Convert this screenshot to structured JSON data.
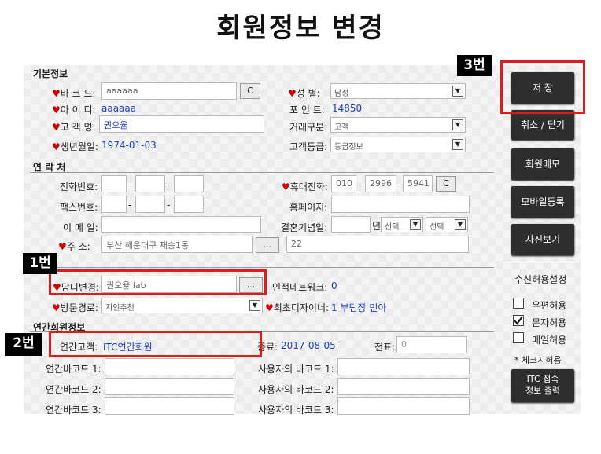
{
  "page_title": "회원정보 변경",
  "tags": {
    "tag1": "1번",
    "tag2": "2번",
    "tag3": "3번"
  },
  "sections": {
    "basic": "기본정보",
    "contact": "연 락 처",
    "annual": "연간회원정보"
  },
  "basic": {
    "barcode_label": "바 코 드:",
    "barcode_value": "aaaaaa",
    "barcode_btn": "C",
    "id_label": "아 이 디:",
    "id_value": "aaaaaa",
    "name_label": "고 객 명:",
    "name_value": "권오율",
    "birth_label": "생년월일:",
    "birth_value": "1974-01-03",
    "gender_label": "성    별:",
    "gender_value": "남성",
    "points_label": "포 인 트:",
    "points_value": "14850",
    "trade_label": "거래구분:",
    "trade_value": "고객",
    "grade_label": "고객등급:",
    "grade_value": "등급정보"
  },
  "contact": {
    "phone_label": "전화번호:",
    "fax_label": "팩스번호:",
    "email_label": "이 메 일:",
    "address_label": "주    소:",
    "address_value": "부산 해운대구 재송1동",
    "address_btn": "...",
    "address_detail": "22",
    "mobile_label": "휴대전화:",
    "mobile_1": "010",
    "mobile_2": "2996",
    "mobile_3": "5941",
    "mobile_btn": "C",
    "homepage_label": "홈페이지:",
    "anniv_label": "결혼기념일:",
    "year_suffix": "년",
    "select_a": "선택",
    "select_b": "선택"
  },
  "manager": {
    "manager_label": "담디변경:",
    "manager_value": "권오율  lab",
    "manager_btn": "...",
    "network_label": "인적네트워크:",
    "network_value": "0",
    "visit_label": "방문경로:",
    "visit_value": "지인추천",
    "designer_label": "최초디자이너:",
    "designer_value": "1 부팀장 민아"
  },
  "annual": {
    "customer_label": "연간고객:",
    "customer_value": "ITC연간회원",
    "end_label": "종료:",
    "end_value": "2017-08-05",
    "ticket_label": "전표:",
    "ticket_value": "0",
    "barcode1": "연간바코드 1:",
    "barcode2": "연간바코드 2:",
    "barcode3": "연간바코드 3:",
    "user_barcode1": "사용자의 바코드 1:",
    "user_barcode2": "사용자의 바코드 2:",
    "user_barcode3": "사용자의 바코드 3:"
  },
  "sidebar": {
    "save": "저  장",
    "cancel": "취소 / 닫기",
    "memo": "회원메모",
    "mobile_reg": "모바일등록",
    "photo": "사진보기",
    "receive_title": "수신허용설정",
    "mail": "우편허용",
    "sms": "문자허용",
    "email": "메일허용",
    "note": "* 체크시허용",
    "itc_line1": "ITC 접속",
    "itc_line2": "정보 출력"
  },
  "checks": {
    "mail": false,
    "sms": true,
    "email": false
  },
  "colors": {
    "accent_red": "#e21a1a",
    "link_blue": "#1a3fc8",
    "heart_red": "#d00000",
    "dark_button": "#2e2e2e"
  }
}
